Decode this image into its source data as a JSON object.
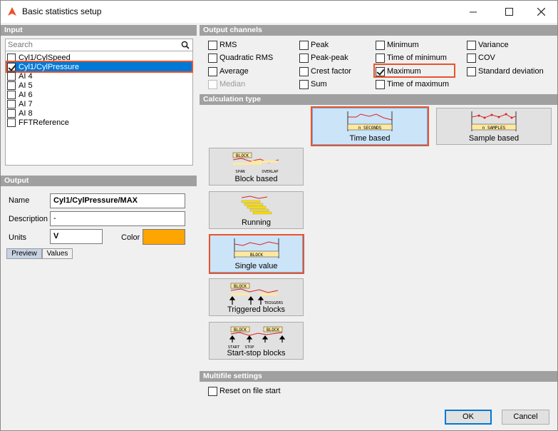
{
  "window": {
    "title": "Basic statistics setup"
  },
  "input": {
    "header": "Input",
    "search_placeholder": "Search",
    "channels": [
      {
        "label": "Cyl1/CylSpeed",
        "checked": false,
        "selected": false
      },
      {
        "label": "Cyl1/CylPressure",
        "checked": true,
        "selected": true
      },
      {
        "label": "AI 4",
        "checked": false,
        "selected": false
      },
      {
        "label": "AI 5",
        "checked": false,
        "selected": false
      },
      {
        "label": "AI 6",
        "checked": false,
        "selected": false
      },
      {
        "label": "AI 7",
        "checked": false,
        "selected": false
      },
      {
        "label": "AI 8",
        "checked": false,
        "selected": false
      },
      {
        "label": "FFTReference",
        "checked": false,
        "selected": false
      }
    ]
  },
  "output": {
    "header": "Output",
    "name_label": "Name",
    "name_value": "Cyl1/CylPressure/MAX",
    "description_label": "Description",
    "description_value": "-",
    "units_label": "Units",
    "units_value": "V",
    "color_label": "Color",
    "color_value": "#ffa500",
    "tabs": [
      {
        "label": "Preview",
        "active": true
      },
      {
        "label": "Values",
        "active": false
      }
    ]
  },
  "output_channels": {
    "header": "Output channels",
    "options": [
      {
        "label": "RMS",
        "checked": false,
        "disabled": false
      },
      {
        "label": "Quadratic RMS",
        "checked": false,
        "disabled": false
      },
      {
        "label": "Average",
        "checked": false,
        "disabled": false
      },
      {
        "label": "Median",
        "checked": false,
        "disabled": true
      },
      {
        "label": "Peak",
        "checked": false,
        "disabled": false
      },
      {
        "label": "Peak-peak",
        "checked": false,
        "disabled": false
      },
      {
        "label": "Crest factor",
        "checked": false,
        "disabled": false
      },
      {
        "label": "Sum",
        "checked": false,
        "disabled": false
      },
      {
        "label": "Minimum",
        "checked": false,
        "disabled": false
      },
      {
        "label": "Time of minimum",
        "checked": false,
        "disabled": false
      },
      {
        "label": "Maximum",
        "checked": true,
        "disabled": false
      },
      {
        "label": "Time of maximum",
        "checked": false,
        "disabled": false
      },
      {
        "label": "Variance",
        "checked": false,
        "disabled": false
      },
      {
        "label": "COV",
        "checked": false,
        "disabled": false
      },
      {
        "label": "Standard deviation",
        "checked": false,
        "disabled": false
      }
    ]
  },
  "calculation_type": {
    "header": "Calculation type",
    "options": [
      {
        "label": "Time based",
        "selected": true,
        "graphic_label": "n SECONDS"
      },
      {
        "label": "Sample based",
        "selected": false,
        "graphic_label": "n SAMPLES"
      },
      {
        "label": "Block based",
        "selected": false,
        "graphic_label": "BLOCK",
        "graphic_label_2": "SPAN",
        "graphic_label_3": "OVERLAP"
      },
      {
        "label": "Running",
        "selected": false
      },
      {
        "label": "Single value",
        "selected": false,
        "graphic_label": "BLOCK"
      },
      {
        "label": "Triggered blocks",
        "selected": false,
        "graphic_label": "BLOCK",
        "graphic_label_2": "TRIGGERS"
      },
      {
        "label": "Start-stop blocks",
        "selected": false,
        "graphic_label": "BLOCK",
        "graphic_label_2": "START",
        "graphic_label_3": "STOP"
      }
    ]
  },
  "multifile": {
    "header": "Multifile settings",
    "reset_label": "Reset on file start",
    "reset_checked": false
  },
  "buttons": {
    "ok": "OK",
    "cancel": "Cancel"
  },
  "colors": {
    "accent": "#0078d7",
    "highlight": "#e8542b",
    "header_bg": "#a0a0a0",
    "selected_button": "#cce4f7"
  }
}
